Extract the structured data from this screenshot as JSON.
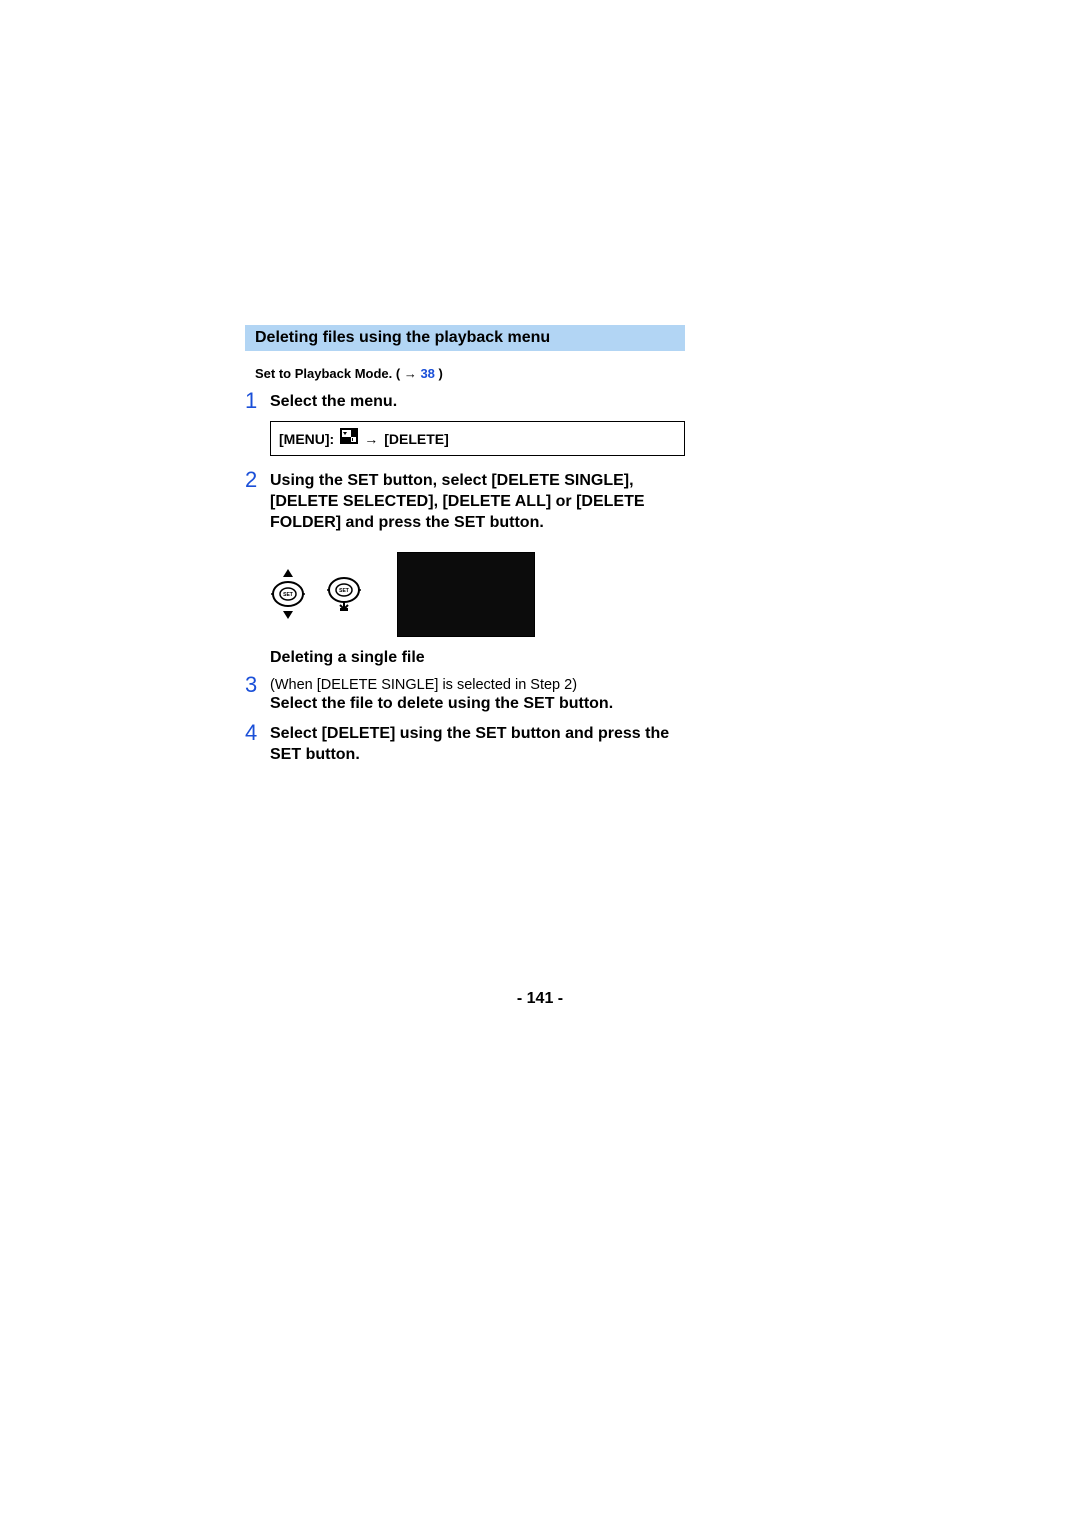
{
  "section_title": "Deleting files using the playback menu",
  "precondition": {
    "text": "Set to Playback Mode. (",
    "link": "38",
    "close": ")"
  },
  "step1": {
    "num": "1",
    "text": "Select the menu."
  },
  "menubox": {
    "label": "[MENU]:",
    "arrow1": "→",
    "item": "[DELETE]"
  },
  "step2": {
    "num": "2",
    "text": "Using the SET button, select [DELETE SINGLE], [DELETE SELECTED], [DELETE ALL] or [DELETE FOLDER] and press the SET button."
  },
  "subheading": "Deleting a single file",
  "step3": {
    "num": "3",
    "line1": "(When [DELETE SINGLE] is selected in Step 2)",
    "line2": "Select the file to delete using the SET button."
  },
  "step4": {
    "num": "4",
    "text": "Select [DELETE] using the SET button and press the SET button."
  },
  "page_number": "- 141 -",
  "icons": {
    "set_button": "SET"
  }
}
